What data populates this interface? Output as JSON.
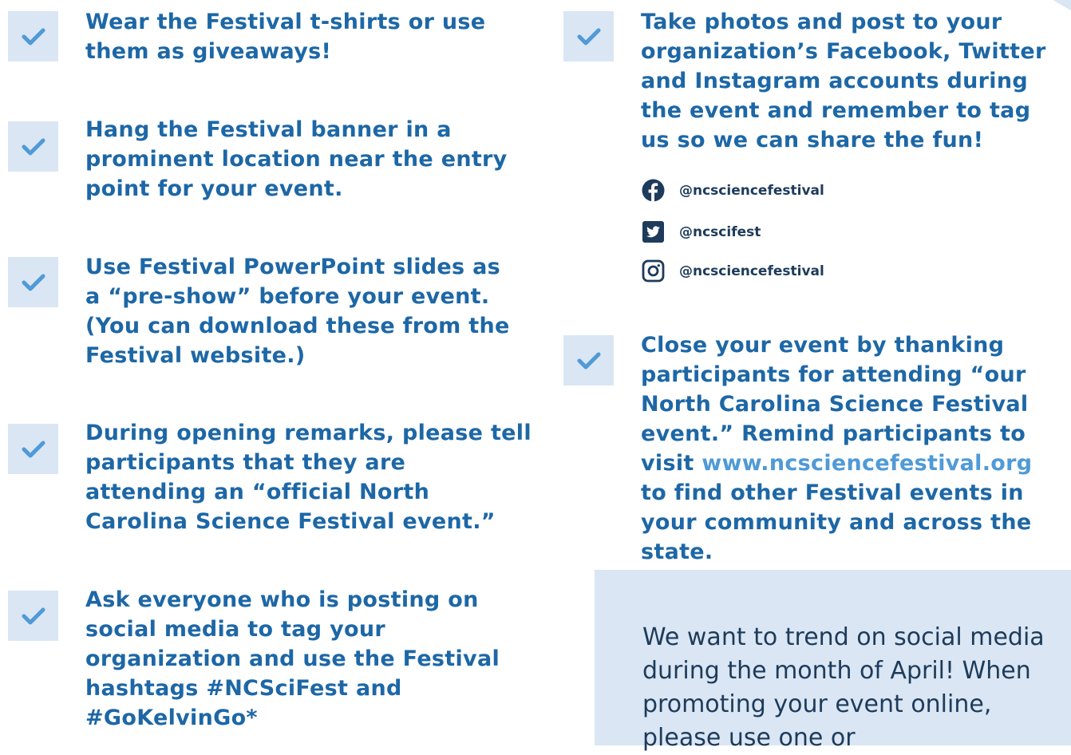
{
  "left_items": [
    {
      "text": "Wear the Festival t-shirts or use them as giveaways!"
    },
    {
      "text": "Hang the Festival banner in a prominent location near the entry point for your event."
    },
    {
      "text": "Use Festival PowerPoint slides as a “pre-show” before your event. (You can download these from the Festival website.)"
    },
    {
      "text": "During opening remarks, please tell participants that they are attending an “official North Carolina Science Festival event.”"
    },
    {
      "text": "Ask everyone who is posting on social media to tag your organization and use the Festival hashtags #NCSciFest and #GoKelvinGo*"
    }
  ],
  "right_items": {
    "photos": "Take photos and post to your organization’s Facebook, Twitter and Instagram accounts during the event and remember to tag us so we can share the fun!",
    "close_before_link": "Close your event by thanking participants for attending “our North Carolina Science Festival event.” Remind participants to visit ",
    "close_link": "www.ncsciencefestival.org",
    "close_after_link": " to find other Festival events in your community and across the state."
  },
  "social": {
    "facebook": {
      "icon": "facebook-icon",
      "handle": "@ncsciencefestival"
    },
    "twitter": {
      "icon": "twitter-icon",
      "handle": "@ncscifest"
    },
    "instagram": {
      "icon": "instagram-icon",
      "handle": "@ncsciencefestival"
    }
  },
  "callout": {
    "text": "We want to trend on social media during the month of April! When promoting your event online, please use one or"
  },
  "colors": {
    "text_blue": "#1d67a6",
    "check_blue": "#4f9ad7",
    "box_bg": "#dae6f3",
    "dark_navy": "#1d3b5b"
  }
}
